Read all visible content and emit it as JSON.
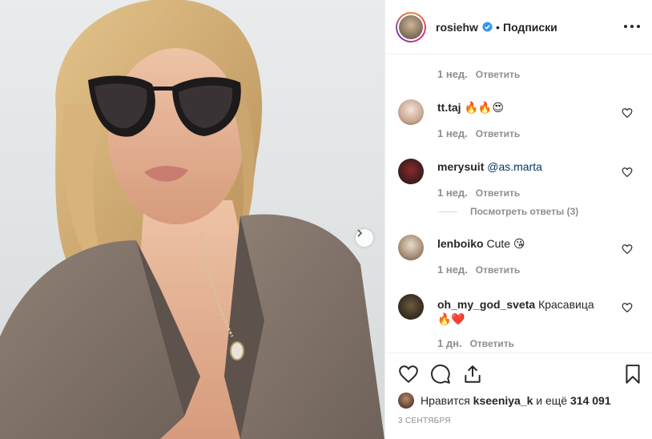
{
  "post": {
    "username": "rosiehw",
    "separator": "•",
    "follow_label": "Подписки",
    "verified": true
  },
  "comments": [
    {
      "age": "1 нед.",
      "reply": "Ответить"
    },
    {
      "user": "tt.taj",
      "text": "🔥🔥😍",
      "age": "1 нед.",
      "reply": "Ответить"
    },
    {
      "user": "merysuit",
      "mention": "@as.marta",
      "age": "1 нед.",
      "reply": "Ответить",
      "replies_label": "Посмотреть ответы (3)"
    },
    {
      "user": "lenboiko",
      "text": "Cute 😘",
      "age": "1 нед.",
      "reply": "Ответить"
    },
    {
      "user": "oh_my_god_sveta",
      "text": "Красавица",
      "text2": "🔥❤️",
      "age": "1 дн.",
      "reply": "Ответить"
    }
  ],
  "likes": {
    "prefix": "Нравится",
    "user": "kseeniya_k",
    "middle": "и ещё",
    "count": "314 091"
  },
  "date": "3 СЕНТЯБРЯ",
  "icons": [
    "heart-icon",
    "comment-icon",
    "share-icon",
    "bookmark-icon",
    "more-icon",
    "verified-icon",
    "chevron-right-icon"
  ],
  "colors": {
    "verified": "#3897f0",
    "link": "#003569",
    "muted": "#8e8e8e",
    "text": "#262626"
  }
}
